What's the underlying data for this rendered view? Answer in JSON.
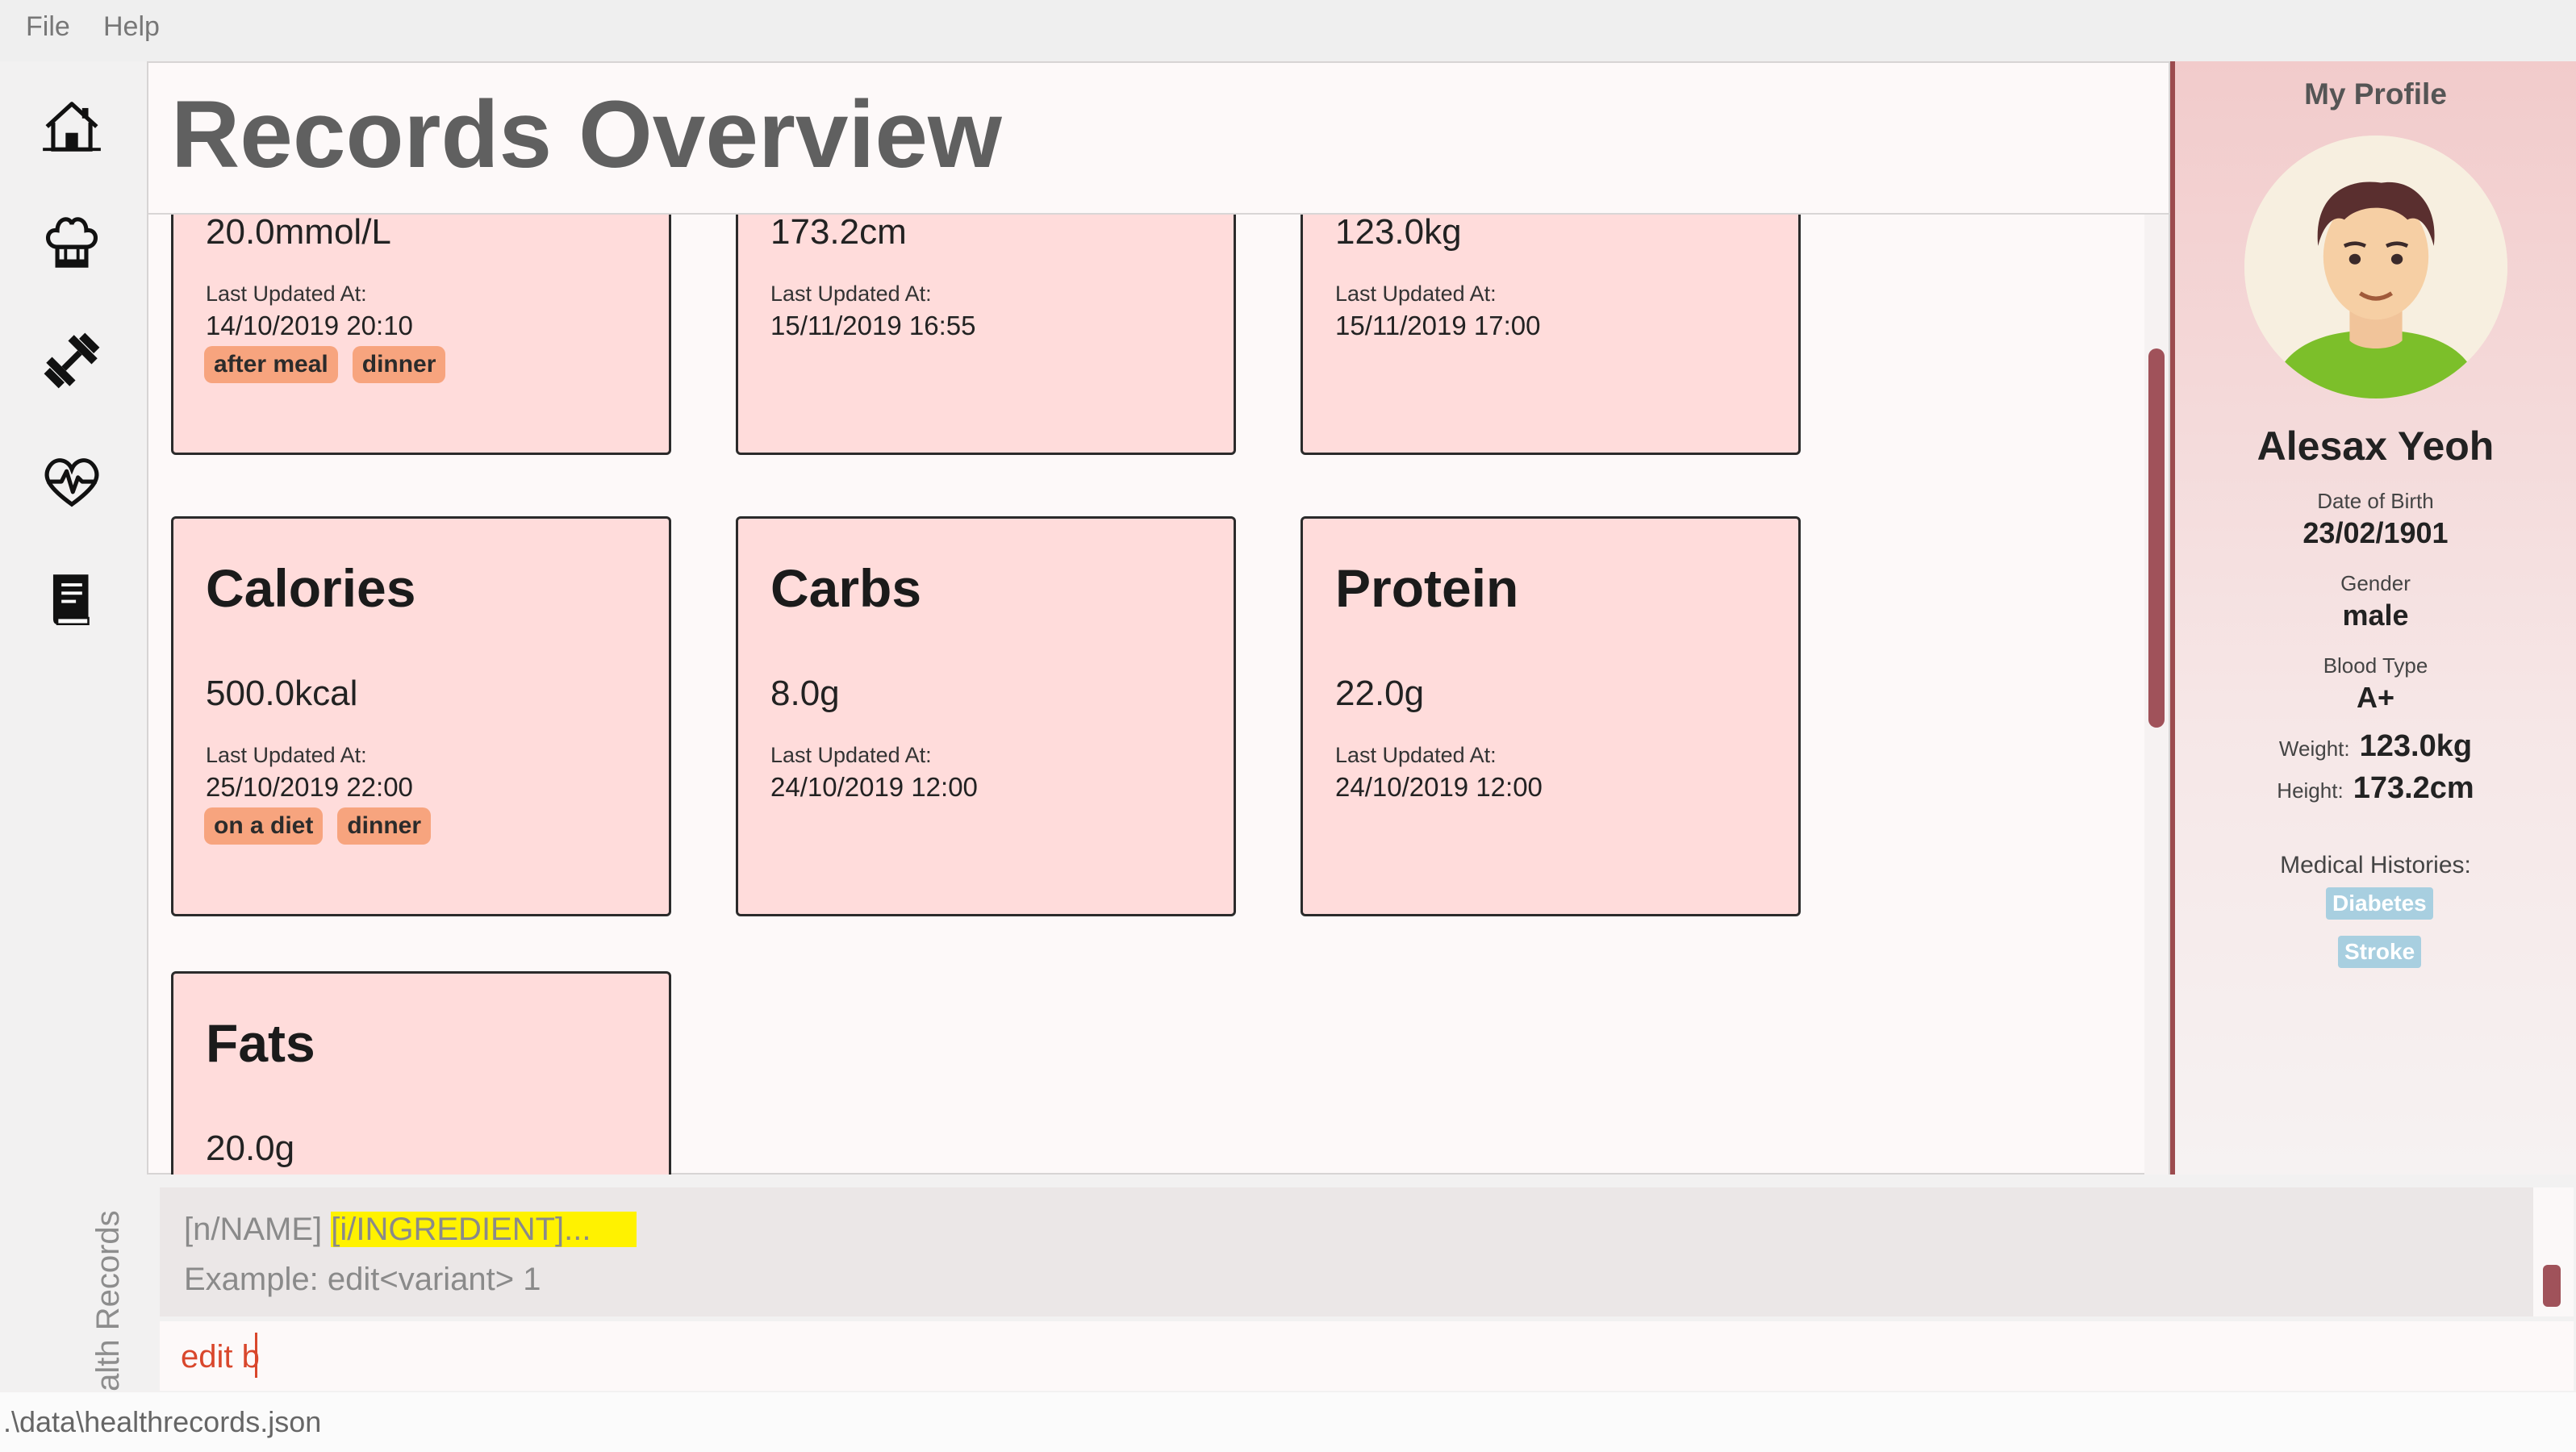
{
  "menubar": {
    "file_label": "File",
    "help_label": "Help"
  },
  "sidebar": {
    "items": [
      {
        "icon": "home-icon"
      },
      {
        "icon": "chef-hat-icon"
      },
      {
        "icon": "dumbbell-icon"
      },
      {
        "icon": "heartbeat-icon"
      },
      {
        "icon": "book-icon"
      }
    ],
    "vertical_title": "Health Records"
  },
  "main": {
    "title": "Records Overview"
  },
  "cards": [
    {
      "title": "",
      "value": "20.0mmol/L",
      "updated_label": "Last Updated At:",
      "updated_value": "14/10/2019 20:10",
      "tags": [
        "after meal",
        "dinner"
      ]
    },
    {
      "title": "",
      "value": "173.2cm",
      "updated_label": "Last Updated At:",
      "updated_value": "15/11/2019 16:55",
      "tags": []
    },
    {
      "title": "",
      "value": "123.0kg",
      "updated_label": "Last Updated At:",
      "updated_value": "15/11/2019 17:00",
      "tags": []
    },
    {
      "title": "Calories",
      "value": "500.0kcal",
      "updated_label": "Last Updated At:",
      "updated_value": "25/10/2019 22:00",
      "tags": [
        "on a diet",
        "dinner"
      ]
    },
    {
      "title": "Carbs",
      "value": "8.0g",
      "updated_label": "Last Updated At:",
      "updated_value": "24/10/2019 12:00",
      "tags": []
    },
    {
      "title": "Protein",
      "value": "22.0g",
      "updated_label": "Last Updated At:",
      "updated_value": "24/10/2019 12:00",
      "tags": []
    },
    {
      "title": "Fats",
      "value": "20.0g",
      "updated_label": "",
      "updated_value": "",
      "tags": []
    }
  ],
  "profile": {
    "heading": "My Profile",
    "name": "Alesax Yeoh",
    "dob_label": "Date of Birth",
    "dob": "23/02/1901",
    "gender_label": "Gender",
    "gender": "male",
    "blood_label": "Blood Type",
    "blood": "A+",
    "weight_label": "Weight:",
    "weight": "123.0kg",
    "height_label": "Height:",
    "height": "173.2cm",
    "histories_label": "Medical Histories:",
    "histories": [
      "Diabetes",
      "Stroke"
    ]
  },
  "result": {
    "line1_prefix": "[n/NAME] ",
    "line1_highlight": "[i/INGREDIENT]...",
    "line2": "Example: edit<variant> 1"
  },
  "command": {
    "value": "edit b"
  },
  "status": {
    "path": ".\\data\\healthrecords.json"
  },
  "colors": {
    "accent": "#a0525a",
    "card_bg": "#ffdcdb",
    "tag": "#f7a47e",
    "history_tag": "#a8cfe0",
    "command_text": "#d9472c"
  }
}
